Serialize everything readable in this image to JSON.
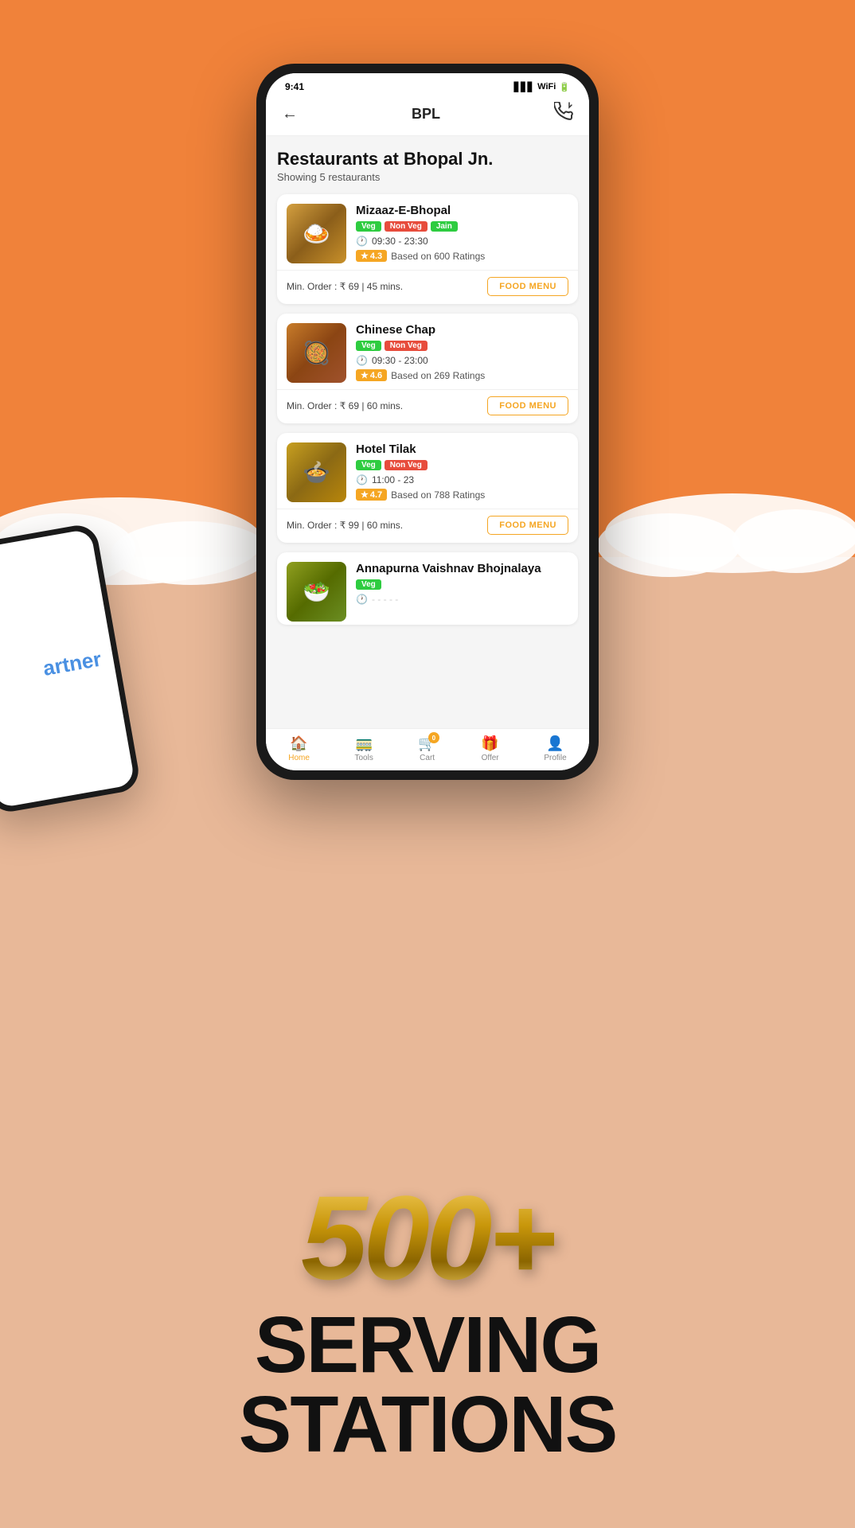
{
  "background": {
    "top_color": "#f0823a",
    "bottom_color": "#e8b898"
  },
  "phone": {
    "header": {
      "back_label": "←",
      "title": "BPL",
      "phone_icon": "📞"
    },
    "page": {
      "title": "Restaurants at Bhopal Jn.",
      "subtitle": "Showing 5 restaurants"
    },
    "restaurants": [
      {
        "name": "Mizaaz-E-Bhopal",
        "tags": [
          "Veg",
          "Non Veg",
          "Jain"
        ],
        "hours": "09:30 - 23:30",
        "rating": "4.3",
        "rating_text": "Based on 600 Ratings",
        "min_order": "Min. Order : ₹ 69 | 45 mins.",
        "button": "FOOD MENU",
        "emoji": "🍛"
      },
      {
        "name": "Chinese Chap",
        "tags": [
          "Veg",
          "Non Veg"
        ],
        "hours": "09:30 - 23:00",
        "rating": "4.6",
        "rating_text": "Based on 269 Ratings",
        "min_order": "Min. Order : ₹ 69 | 60 mins.",
        "button": "FOOD MENU",
        "emoji": "🥘"
      },
      {
        "name": "Hotel Tilak",
        "tags": [
          "Veg",
          "Non Veg"
        ],
        "hours": "11:00 - 23",
        "rating": "4.7",
        "rating_text": "Based on 788 Ratings",
        "min_order": "Min. Order : ₹ 99 | 60 mins.",
        "button": "FOOD MENU",
        "emoji": "🍲"
      },
      {
        "name": "Annapurna Vaishnav Bhojnalaya",
        "tags": [
          "Veg"
        ],
        "hours": "",
        "rating": "",
        "rating_text": "",
        "min_order": "",
        "button": "",
        "emoji": "🥗"
      }
    ],
    "bottom_nav": [
      {
        "label": "Home",
        "icon": "🏠",
        "active": true
      },
      {
        "label": "Tools",
        "icon": "🚃",
        "active": false
      },
      {
        "label": "Cart",
        "icon": "🛒",
        "active": false,
        "badge": "0"
      },
      {
        "label": "Offer",
        "icon": "🎁",
        "active": false
      },
      {
        "label": "Profile",
        "icon": "👤",
        "active": false
      }
    ]
  },
  "bottom_promo": {
    "number": "500",
    "plus": "+",
    "line1": "SERVING",
    "line2": "STATIONS"
  },
  "partner_phone": {
    "text": "artner"
  }
}
